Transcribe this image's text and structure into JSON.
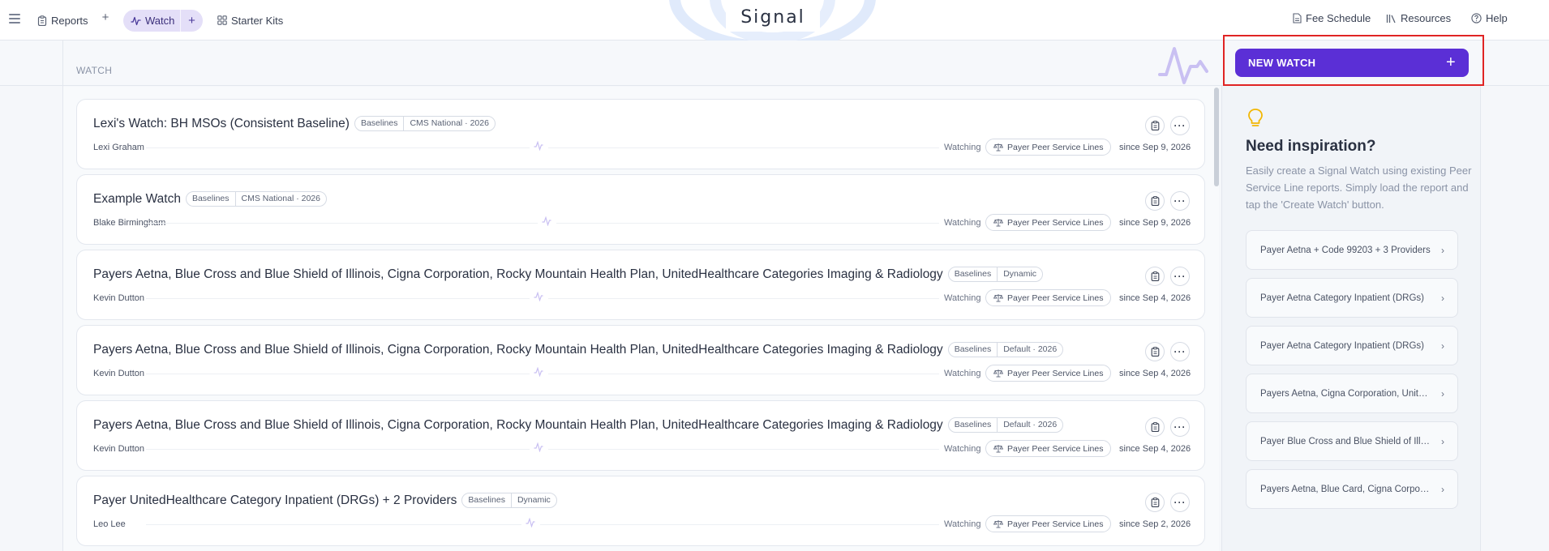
{
  "topbar": {
    "reports_label": "Reports",
    "watch_label": "Watch",
    "starter_kits_label": "Starter Kits",
    "logo": "Signal",
    "fee_schedule_label": "Fee Schedule",
    "resources_label": "Resources",
    "help_label": "Help"
  },
  "section_label": "WATCH",
  "watches": [
    {
      "title": "Lexi's Watch: BH MSOs (Consistent Baseline)",
      "tags": [
        "Baselines",
        "CMS National · 2026"
      ],
      "owner": "Lexi Graham",
      "status": "Watching",
      "peer": "Payer Peer Service Lines",
      "since": "since Sep 9, 2026"
    },
    {
      "title": "Example Watch",
      "tags": [
        "Baselines",
        "CMS National · 2026"
      ],
      "owner": "Blake Birmingham",
      "status": "Watching",
      "peer": "Payer Peer Service Lines",
      "since": "since Sep 9, 2026"
    },
    {
      "title": "Payers Aetna, Blue Cross and Blue Shield of Illinois, Cigna Corporation, Rocky Mountain Health Plan, UnitedHealthcare Categories Imaging & Radiology",
      "tags": [
        "Baselines",
        "Dynamic"
      ],
      "owner": "Kevin Dutton",
      "status": "Watching",
      "peer": "Payer Peer Service Lines",
      "since": "since Sep 4, 2026"
    },
    {
      "title": "Payers Aetna, Blue Cross and Blue Shield of Illinois, Cigna Corporation, Rocky Mountain Health Plan, UnitedHealthcare Categories Imaging & Radiology",
      "tags": [
        "Baselines",
        "Default · 2026"
      ],
      "owner": "Kevin Dutton",
      "status": "Watching",
      "peer": "Payer Peer Service Lines",
      "since": "since Sep 4, 2026"
    },
    {
      "title": "Payers Aetna, Blue Cross and Blue Shield of Illinois, Cigna Corporation, Rocky Mountain Health Plan, UnitedHealthcare Categories Imaging & Radiology",
      "tags": [
        "Baselines",
        "Default · 2026"
      ],
      "owner": "Kevin Dutton",
      "status": "Watching",
      "peer": "Payer Peer Service Lines",
      "since": "since Sep 4, 2026"
    },
    {
      "title": "Payer UnitedHealthcare Category Inpatient (DRGs) + 2 Providers",
      "tags": [
        "Baselines",
        "Dynamic"
      ],
      "owner": "Leo Lee",
      "status": "Watching",
      "peer": "Payer Peer Service Lines",
      "since": "since Sep 2, 2026"
    }
  ],
  "panel": {
    "new_watch_label": "NEW WATCH",
    "title": "Need inspiration?",
    "description": "Easily create a Signal Watch using existing Peer Service Line reports. Simply load the report and tap the 'Create Watch' button.",
    "suggestions": [
      "Payer Aetna + Code 99203 + 3 Providers",
      "Payer Aetna Category Inpatient (DRGs)",
      "Payer Aetna Category Inpatient (DRGs)",
      "Payers Aetna, Cigna Corporation, UnitedHealthcare",
      "Payer Blue Cross and Blue Shield of Illinois",
      "Payers Aetna, Blue Card, Cigna Corporation"
    ]
  },
  "colors": {
    "accent": "#5b2fd6",
    "highlight": "#e02424",
    "watch_pill": "#e4dff8"
  }
}
